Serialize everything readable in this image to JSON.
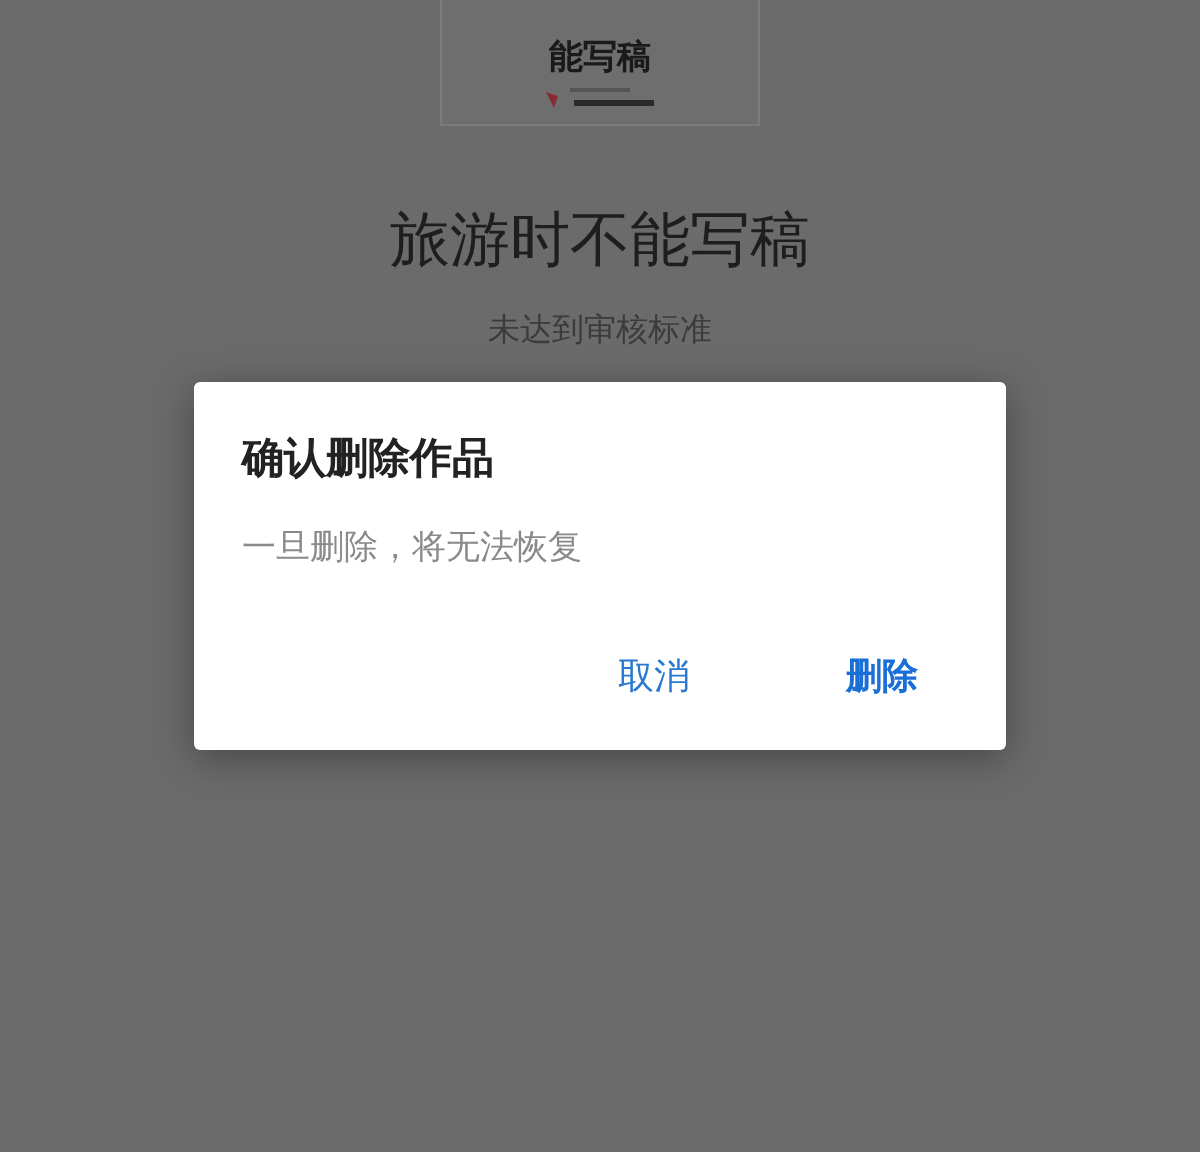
{
  "cover": {
    "title": "能写稿"
  },
  "work": {
    "title": "旅游时不能写稿",
    "status": "未达到审核标准"
  },
  "dialog": {
    "title": "确认删除作品",
    "message": "一旦删除，将无法恢复",
    "buttons": [
      {
        "label": "取消",
        "kind": "cancel"
      },
      {
        "label": "删除",
        "kind": "confirm"
      }
    ]
  }
}
